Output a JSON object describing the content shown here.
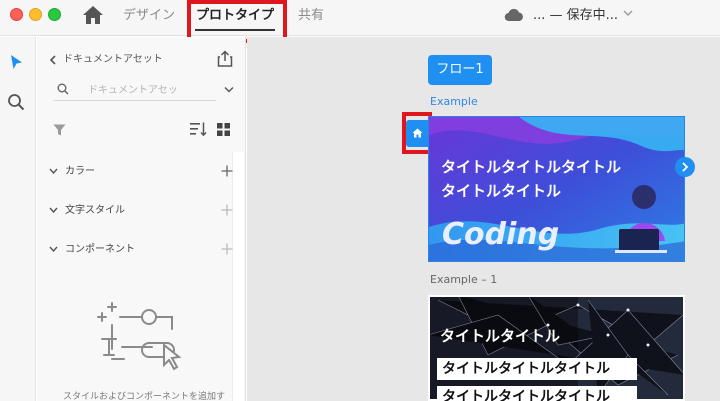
{
  "titlebar": {
    "tabs": {
      "design": "デザイン",
      "prototype": "プロトタイプ",
      "share": "共有"
    },
    "save_status": "... — 保存中..."
  },
  "panel": {
    "title": "ドキュメントアセット",
    "search_placeholder": "ドキュメントアセッ",
    "sections": {
      "colors": "カラー",
      "text_styles": "文字スタイル",
      "components": "コンポーネント"
    },
    "empty_text": "スタイルおよびコンポーネントを追加す"
  },
  "canvas": {
    "flow_button": "フロー1",
    "artboards": [
      {
        "label": "Example",
        "line1": "タイトルタイトルタイトル",
        "line2": "タイトルタイトル",
        "hero_text": "Coding"
      },
      {
        "label": "Example – 1",
        "title": "タイトルタイトル",
        "box1": "タイトルタイトルタイトル",
        "box2": "タイトルタイトルタイトル"
      }
    ]
  },
  "colors": {
    "accent": "#1f8ff2",
    "highlight_frame": "#e0161e"
  }
}
